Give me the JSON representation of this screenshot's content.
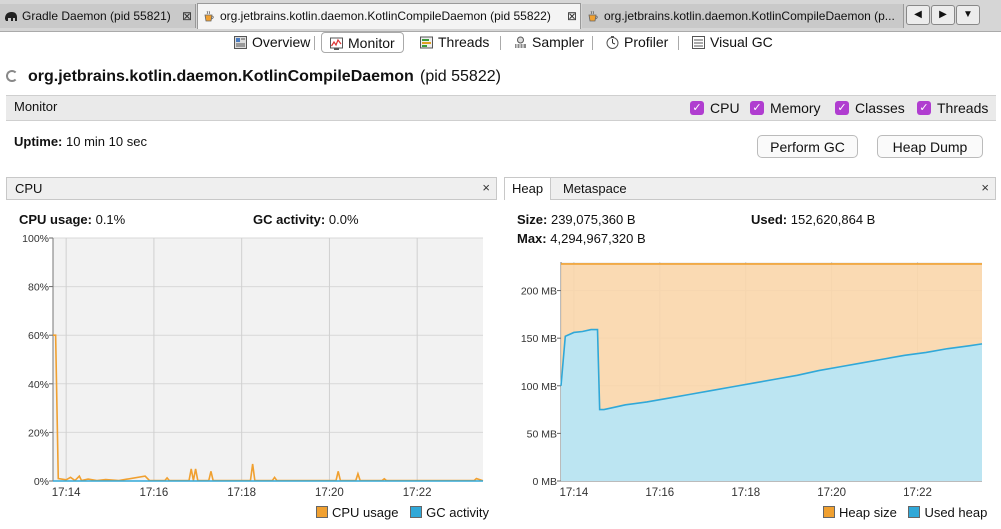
{
  "document_tabs": [
    {
      "label": "Gradle Daemon (pid 55821)",
      "close": "⊠",
      "icon": "gradle-elephant-icon"
    },
    {
      "label": "org.jetbrains.kotlin.daemon.KotlinCompileDaemon (pid 55822)",
      "close": "⊠",
      "icon": "java-cup-icon"
    },
    {
      "label": "org.jetbrains.kotlin.daemon.KotlinCompileDaemon (p...",
      "close": "",
      "icon": "java-cup-icon"
    }
  ],
  "view_tabs": [
    {
      "label": "Overview",
      "icon": "overview-icon"
    },
    {
      "label": "Monitor",
      "icon": "monitor-icon",
      "active": true
    },
    {
      "label": "Threads",
      "icon": "threads-icon"
    },
    {
      "label": "Sampler",
      "icon": "sampler-icon"
    },
    {
      "label": "Profiler",
      "icon": "profiler-icon"
    },
    {
      "label": "Visual GC",
      "icon": "visual-gc-icon"
    }
  ],
  "process": {
    "name": "org.jetbrains.kotlin.daemon.KotlinCompileDaemon",
    "pid": "(pid 55822)"
  },
  "monitor": {
    "label": "Monitor",
    "checkboxes": [
      {
        "label": "CPU",
        "checked": true
      },
      {
        "label": "Memory",
        "checked": true
      },
      {
        "label": "Classes",
        "checked": true
      },
      {
        "label": "Threads",
        "checked": true
      }
    ],
    "uptime_label": "Uptime:",
    "uptime_value": "10 min 10 sec",
    "perform_gc": "Perform GC",
    "heap_dump": "Heap Dump"
  },
  "cpu_panel": {
    "title": "CPU",
    "close": "×",
    "usage_label": "CPU usage:",
    "usage_value": "0.1%",
    "gc_label": "GC activity:",
    "gc_value": "0.0%"
  },
  "heap_panel": {
    "tab_heap": "Heap",
    "tab_metaspace": "Metaspace",
    "close": "×",
    "size_label": "Size:",
    "size_value": "239,075,360 B",
    "used_label": "Used:",
    "used_value": "152,620,864 B",
    "max_label": "Max:",
    "max_value": "4,294,967,320 B"
  },
  "colors": {
    "orange": "#f0a030",
    "blue": "#30a8d8",
    "purple": "#b03dd0"
  },
  "chart_data": [
    {
      "type": "line",
      "name": "cpu",
      "y_ticks": [
        "100%",
        "80%",
        "60%",
        "40%",
        "20%",
        "0%"
      ],
      "x_ticks": [
        "17:14",
        "17:16",
        "17:18",
        "17:20",
        "17:22"
      ],
      "ylim": [
        0,
        100
      ],
      "xlim_min": [
        0.0,
        9.8
      ],
      "x_tick_values": [
        0.3,
        2.3,
        4.3,
        6.3,
        8.3
      ],
      "grid": true,
      "legend": "bottom-right",
      "series": [
        {
          "name": "CPU usage",
          "color": "#f0a030",
          "points": [
            [
              0.0,
              60
            ],
            [
              0.06,
              60
            ],
            [
              0.12,
              1
            ],
            [
              0.3,
              0.5
            ],
            [
              0.4,
              1.5
            ],
            [
              0.5,
              0.2
            ],
            [
              0.6,
              2
            ],
            [
              0.65,
              0.2
            ],
            [
              0.8,
              0.8
            ],
            [
              1.0,
              0.2
            ],
            [
              1.2,
              0.6
            ],
            [
              1.5,
              0.2
            ],
            [
              2.1,
              2
            ],
            [
              2.2,
              0.2
            ],
            [
              2.55,
              0.2
            ],
            [
              2.6,
              1.3
            ],
            [
              2.65,
              0.2
            ],
            [
              3.1,
              0.2
            ],
            [
              3.15,
              5
            ],
            [
              3.2,
              0.2
            ],
            [
              3.25,
              5
            ],
            [
              3.3,
              0.2
            ],
            [
              3.55,
              0.2
            ],
            [
              3.6,
              4
            ],
            [
              3.65,
              0.2
            ],
            [
              4.5,
              0.2
            ],
            [
              4.55,
              7
            ],
            [
              4.6,
              0.2
            ],
            [
              5.0,
              0.2
            ],
            [
              5.05,
              1.5
            ],
            [
              5.1,
              0.2
            ],
            [
              6.45,
              0.2
            ],
            [
              6.5,
              4
            ],
            [
              6.55,
              0.2
            ],
            [
              6.9,
              0.2
            ],
            [
              6.95,
              3
            ],
            [
              7.0,
              0.2
            ],
            [
              7.5,
              0.2
            ],
            [
              7.55,
              0.9
            ],
            [
              7.6,
              0.2
            ],
            [
              9.6,
              0.2
            ],
            [
              9.65,
              1
            ],
            [
              9.8,
              0.1
            ]
          ]
        },
        {
          "name": "GC activity",
          "color": "#30a8d8",
          "points": [
            [
              0.0,
              0
            ],
            [
              9.8,
              0
            ]
          ]
        }
      ]
    },
    {
      "type": "area",
      "name": "heap",
      "y_ticks": [
        "200 MB",
        "150 MB",
        "100 MB",
        "50 MB",
        "0 MB"
      ],
      "y_tick_values": [
        200,
        150,
        100,
        50,
        0
      ],
      "x_ticks": [
        "17:14",
        "17:16",
        "17:18",
        "17:20",
        "17:22"
      ],
      "ylim": [
        0,
        230
      ],
      "xlim_min": [
        0.0,
        9.8
      ],
      "x_tick_values": [
        0.3,
        2.3,
        4.3,
        6.3,
        8.3
      ],
      "grid": true,
      "legend": "bottom-right",
      "series": [
        {
          "name": "Heap size",
          "color": "#f0a030",
          "points": [
            [
              0.0,
              228
            ],
            [
              9.8,
              228
            ]
          ]
        },
        {
          "name": "Used heap",
          "color": "#30a8d8",
          "points": [
            [
              0.0,
              100
            ],
            [
              0.1,
              152
            ],
            [
              0.2,
              154
            ],
            [
              0.3,
              156
            ],
            [
              0.5,
              157
            ],
            [
              0.7,
              159
            ],
            [
              0.85,
              159
            ],
            [
              0.9,
              75
            ],
            [
              1.0,
              75
            ],
            [
              1.2,
              77
            ],
            [
              1.5,
              80
            ],
            [
              2.0,
              83
            ],
            [
              2.5,
              87
            ],
            [
              3.0,
              91
            ],
            [
              3.5,
              95
            ],
            [
              4.0,
              99
            ],
            [
              4.5,
              103
            ],
            [
              5.0,
              107
            ],
            [
              5.5,
              111
            ],
            [
              6.0,
              116
            ],
            [
              6.5,
              120
            ],
            [
              7.0,
              124
            ],
            [
              7.5,
              128
            ],
            [
              8.0,
              132
            ],
            [
              8.5,
              135
            ],
            [
              9.0,
              139
            ],
            [
              9.5,
              142
            ],
            [
              9.8,
              144
            ]
          ]
        }
      ]
    }
  ]
}
